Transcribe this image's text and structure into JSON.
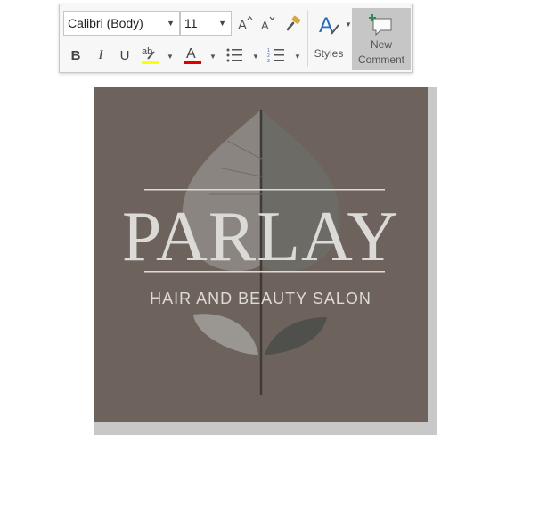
{
  "mini_toolbar": {
    "font_name": "Calibri (Body)",
    "font_size": "11",
    "grow_font_icon": "font-grow-icon",
    "shrink_font_icon": "font-shrink-icon",
    "format_painter_icon": "format-painter-icon",
    "bold_label": "B",
    "italic_label": "I",
    "underline_label": "U",
    "highlight_label": "ab",
    "highlight_color": "#ffff00",
    "font_color_label": "A",
    "font_color": "#e00000",
    "styles_label": "Styles",
    "new_comment_label_line1": "New",
    "new_comment_label_line2": "Comment"
  },
  "document": {
    "logo": {
      "wordmark": "PARLAY",
      "tagline": "HAIR AND BEAUTY SALON",
      "background_color": "#6e625c"
    }
  }
}
